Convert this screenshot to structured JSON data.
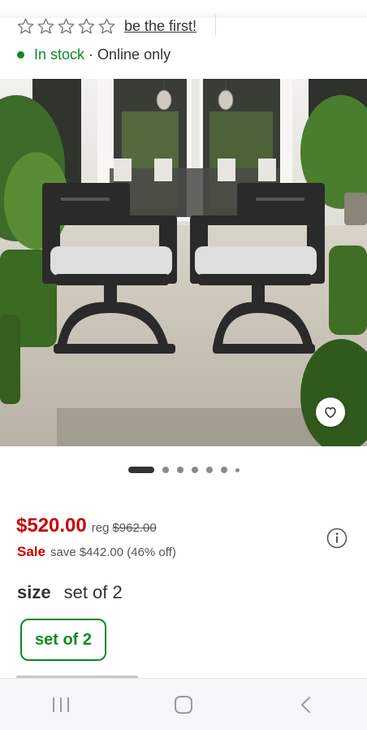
{
  "rating": {
    "stars_filled": 0,
    "stars_total": 5,
    "link_text": "be the first!"
  },
  "availability": {
    "status": "In stock",
    "separator": "·",
    "channel": "Online only",
    "status_color": "#0c8a24"
  },
  "gallery": {
    "image_alt": "Two black swivel patio dining chairs with light gray cushions on a stone patio",
    "total_images": 7,
    "active_index": 0
  },
  "pricing": {
    "price": "$520.00",
    "reg_label": "reg",
    "reg_price": "$962.00",
    "sale_label": "Sale",
    "save_text": "save $442.00 (46% off)",
    "price_color": "#cc0000"
  },
  "size": {
    "label": "size",
    "selected": "set of 2",
    "options": [
      "set of 2"
    ]
  },
  "icons": {
    "favorite": "heart-icon",
    "info": "info-icon",
    "nav_recents": "recent-apps-icon",
    "nav_home": "home-icon",
    "nav_back": "back-icon"
  }
}
